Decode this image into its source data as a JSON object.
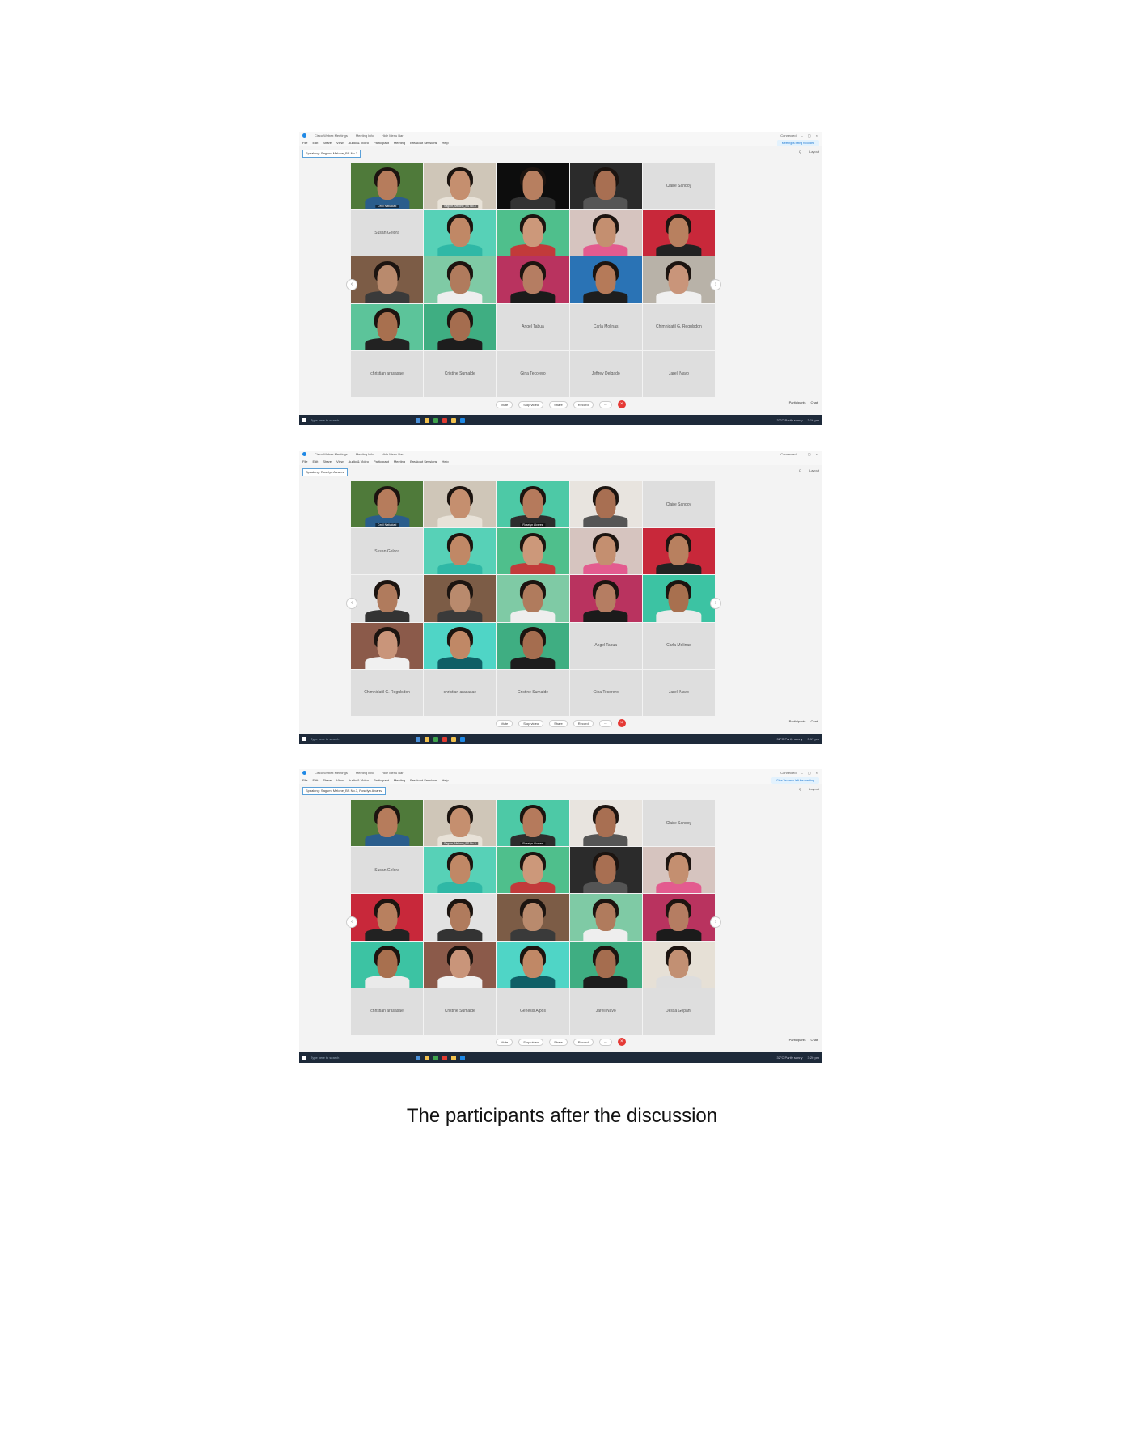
{
  "screenshots": [
    {
      "title_items": [
        "Cisco Webex Meetings",
        "Meeting Info",
        "Hide Menu Bar"
      ],
      "window_status": "Connected",
      "menu": [
        "File",
        "Edit",
        "Share",
        "View",
        "Audio & Video",
        "Participant",
        "Meeting",
        "Breakout Sessions",
        "Help"
      ],
      "banner": "Meeting is being recorded",
      "speaking": "Speaking: Sagum, Melone_BS No.3",
      "top_right": [
        "Q",
        "Layout"
      ],
      "tiles": [
        {
          "type": "video",
          "label": "Cecil Natividad",
          "active": true,
          "bg": "#4f7a3a",
          "skin": "#b67c5c",
          "shirt": "#2a5d8c"
        },
        {
          "type": "video",
          "label": "Sagum, Melone_BS No.3",
          "active": true,
          "bg": "#cfc6b8",
          "skin": "#c58f6f",
          "shirt": "#e8e2d8"
        },
        {
          "type": "video",
          "label": "",
          "bg": "#0d0d0d",
          "skin": "#b77f60",
          "shirt": "#333333"
        },
        {
          "type": "video",
          "label": "",
          "bg": "#2b2b2b",
          "skin": "#a86f52",
          "shirt": "#555555"
        },
        {
          "type": "name",
          "name": "Claire Sandoy"
        },
        {
          "type": "name",
          "name": "Susan Gelora"
        },
        {
          "type": "video",
          "label": "",
          "bg": "#57d1b7",
          "skin": "#c08866",
          "shirt": "#2fb8a6"
        },
        {
          "type": "video",
          "label": "",
          "bg": "#4fbf8c",
          "skin": "#cc987a",
          "shirt": "#c23a3a"
        },
        {
          "type": "video",
          "label": "",
          "bg": "#d6c4bf",
          "skin": "#c48f70",
          "shirt": "#e35b8f"
        },
        {
          "type": "video",
          "label": "",
          "bg": "#c8283a",
          "skin": "#b8805f",
          "shirt": "#222222"
        },
        {
          "type": "video",
          "label": "",
          "bg": "#7c5c46",
          "skin": "#b98a6d",
          "shirt": "#3a3a3a"
        },
        {
          "type": "video",
          "label": "",
          "bg": "#7fcaa5",
          "skin": "#b07b5d",
          "shirt": "#eeeeee"
        },
        {
          "type": "video",
          "label": "",
          "bg": "#b9335f",
          "skin": "#b57d62",
          "shirt": "#1b1b1b"
        },
        {
          "type": "video",
          "label": "",
          "bg": "#2a73b5",
          "skin": "#b57a59",
          "shirt": "#1e1e1e"
        },
        {
          "type": "video",
          "label": "",
          "bg": "#b8b2a8",
          "skin": "#c9957a",
          "shirt": "#f0f0f0"
        },
        {
          "type": "video",
          "label": "",
          "bg": "#5cc49a",
          "skin": "#a8704f",
          "shirt": "#222222"
        },
        {
          "type": "video",
          "label": "",
          "bg": "#3fae82",
          "skin": "#a56d4f",
          "shirt": "#1d1d1d"
        },
        {
          "type": "name",
          "name": "Angel Tabua"
        },
        {
          "type": "name",
          "name": "Carla Molinas"
        },
        {
          "type": "name",
          "name": "Chimnidatil G. Regulsdon"
        },
        {
          "type": "name",
          "name": "christian arasasae"
        },
        {
          "type": "name",
          "name": "Cristine Sumalde"
        },
        {
          "type": "name",
          "name": "Gina Tecorero"
        },
        {
          "type": "name",
          "name": "Jeffrey Delgado"
        },
        {
          "type": "name",
          "name": "Jarell Navo"
        }
      ],
      "controls": [
        "Mute",
        "Stop video",
        "Share",
        "Record"
      ],
      "right_controls": [
        "Participants",
        "Chat"
      ],
      "taskbar_search": "Type here to search",
      "taskbar_tray": "32°C Partly sunny",
      "taskbar_time": "3:16 pm"
    },
    {
      "title_items": [
        "Cisco Webex Meetings",
        "Meeting Info",
        "Hide Menu Bar"
      ],
      "window_status": "Connected",
      "menu": [
        "File",
        "Edit",
        "Share",
        "View",
        "Audio & Video",
        "Participant",
        "Meeting",
        "Breakout Sessions",
        "Help"
      ],
      "banner": "",
      "speaking": "Speaking: Roselyn Alvarez",
      "top_right": [
        "Q",
        "Layout"
      ],
      "tiles": [
        {
          "type": "video",
          "label": "Cecil Natividad",
          "active": true,
          "bg": "#4f7a3a",
          "skin": "#b67c5c",
          "shirt": "#2a5d8c"
        },
        {
          "type": "video",
          "label": "",
          "bg": "#cfc6b8",
          "skin": "#c58f6f",
          "shirt": "#e8e2d8"
        },
        {
          "type": "video",
          "label": "Roselyn Alvarez",
          "active": true,
          "bg": "#4dc9a6",
          "skin": "#b57a5c",
          "shirt": "#2d2d2d"
        },
        {
          "type": "video",
          "label": "",
          "bg": "#e8e4df",
          "skin": "#a86f52",
          "shirt": "#555555"
        },
        {
          "type": "name",
          "name": "Claire Sandoy"
        },
        {
          "type": "name",
          "name": "Susan Gelora"
        },
        {
          "type": "video",
          "label": "",
          "bg": "#57d1b7",
          "skin": "#c08866",
          "shirt": "#2fb8a6"
        },
        {
          "type": "video",
          "label": "",
          "bg": "#4fbf8c",
          "skin": "#cc987a",
          "shirt": "#c23a3a"
        },
        {
          "type": "video",
          "label": "",
          "bg": "#d6c4bf",
          "skin": "#c48f70",
          "shirt": "#e35b8f"
        },
        {
          "type": "video",
          "label": "",
          "bg": "#c8283a",
          "skin": "#b8805f",
          "shirt": "#222222"
        },
        {
          "type": "video",
          "label": "",
          "bg": "#e2e2e2",
          "skin": "#b07b5d",
          "shirt": "#333333"
        },
        {
          "type": "video",
          "label": "",
          "bg": "#7c5c46",
          "skin": "#b98a6d",
          "shirt": "#3a3a3a"
        },
        {
          "type": "video",
          "label": "",
          "bg": "#7fcaa5",
          "skin": "#b07b5d",
          "shirt": "#eeeeee"
        },
        {
          "type": "video",
          "label": "",
          "bg": "#b9335f",
          "skin": "#b57d62",
          "shirt": "#1b1b1b"
        },
        {
          "type": "video",
          "label": "",
          "bg": "#3cc3a3",
          "skin": "#a8704f",
          "shirt": "#eaeaea"
        },
        {
          "type": "video",
          "label": "",
          "bg": "#8b5a4a",
          "skin": "#c9957a",
          "shirt": "#f0f0f0"
        },
        {
          "type": "video",
          "label": "",
          "bg": "#4fd5c6",
          "skin": "#c08866",
          "shirt": "#0f5f66"
        },
        {
          "type": "video",
          "label": "",
          "bg": "#3fae82",
          "skin": "#a56d4f",
          "shirt": "#1d1d1d"
        },
        {
          "type": "name",
          "name": "Angel Tabua"
        },
        {
          "type": "name",
          "name": "Carla Molinas"
        },
        {
          "type": "name",
          "name": "Chimnidatil G. Regulsdon"
        },
        {
          "type": "name",
          "name": "christian arasasae"
        },
        {
          "type": "name",
          "name": "Cristine Sumalde"
        },
        {
          "type": "name",
          "name": "Gina Tecorero"
        },
        {
          "type": "name",
          "name": "Jarell Navo"
        }
      ],
      "controls": [
        "Mute",
        "Stop video",
        "Share",
        "Record"
      ],
      "right_controls": [
        "Participants",
        "Chat"
      ],
      "taskbar_search": "Type here to search",
      "taskbar_tray": "32°C Partly sunny",
      "taskbar_time": "3:17 pm"
    },
    {
      "title_items": [
        "Cisco Webex Meetings",
        "Meeting Info",
        "Hide Menu Bar"
      ],
      "window_status": "Connected",
      "menu": [
        "File",
        "Edit",
        "Share",
        "View",
        "Audio & Video",
        "Participant",
        "Meeting",
        "Breakout Sessions",
        "Help"
      ],
      "banner": "Gina Tecorero left the meeting",
      "speaking": "Speaking: Sagum, Melone_BS No.3, Roselyn Alvarez",
      "top_right": [
        "Q",
        "Layout"
      ],
      "tiles": [
        {
          "type": "video",
          "label": "",
          "bg": "#4f7a3a",
          "skin": "#b67c5c",
          "shirt": "#2a5d8c"
        },
        {
          "type": "video",
          "label": "Sagum, Melone_BS No.3",
          "active": true,
          "bg": "#cfc6b8",
          "skin": "#c58f6f",
          "shirt": "#e8e2d8"
        },
        {
          "type": "video",
          "label": "Roselyn Alvarez",
          "active": true,
          "bg": "#4dc9a6",
          "skin": "#b57a5c",
          "shirt": "#2d2d2d"
        },
        {
          "type": "video",
          "label": "",
          "bg": "#e8e4df",
          "skin": "#a86f52",
          "shirt": "#555555"
        },
        {
          "type": "name",
          "name": "Claire Sandoy"
        },
        {
          "type": "name",
          "name": "Susan Gelora"
        },
        {
          "type": "video",
          "label": "",
          "bg": "#57d1b7",
          "skin": "#c08866",
          "shirt": "#2fb8a6"
        },
        {
          "type": "video",
          "label": "",
          "bg": "#4fbf8c",
          "skin": "#cc987a",
          "shirt": "#c23a3a"
        },
        {
          "type": "video",
          "label": "",
          "bg": "#2b2b2b",
          "skin": "#a86f52",
          "shirt": "#555555"
        },
        {
          "type": "video",
          "label": "",
          "bg": "#d6c4bf",
          "skin": "#c48f70",
          "shirt": "#e35b8f"
        },
        {
          "type": "video",
          "label": "",
          "bg": "#c8283a",
          "skin": "#b8805f",
          "shirt": "#222222"
        },
        {
          "type": "video",
          "label": "",
          "bg": "#e2e2e2",
          "skin": "#b07b5d",
          "shirt": "#333333"
        },
        {
          "type": "video",
          "label": "",
          "bg": "#7c5c46",
          "skin": "#b98a6d",
          "shirt": "#3a3a3a"
        },
        {
          "type": "video",
          "label": "",
          "bg": "#7fcaa5",
          "skin": "#b07b5d",
          "shirt": "#eeeeee"
        },
        {
          "type": "video",
          "label": "",
          "bg": "#b9335f",
          "skin": "#b57d62",
          "shirt": "#1b1b1b"
        },
        {
          "type": "video",
          "label": "",
          "bg": "#3cc3a3",
          "skin": "#a8704f",
          "shirt": "#eaeaea"
        },
        {
          "type": "video",
          "label": "",
          "bg": "#8b5a4a",
          "skin": "#c9957a",
          "shirt": "#f0f0f0"
        },
        {
          "type": "video",
          "label": "",
          "bg": "#4fd5c6",
          "skin": "#c08866",
          "shirt": "#0f5f66"
        },
        {
          "type": "video",
          "label": "",
          "bg": "#3fae82",
          "skin": "#a56d4f",
          "shirt": "#1d1d1d"
        },
        {
          "type": "video",
          "label": "",
          "bg": "#e6e0d6",
          "skin": "#c29073",
          "shirt": "#dddddd"
        },
        {
          "type": "name",
          "name": "christian arasasae"
        },
        {
          "type": "name",
          "name": "Cristine Sumalde"
        },
        {
          "type": "name",
          "name": "Genesis Alpos"
        },
        {
          "type": "name",
          "name": "Jarell Navo"
        },
        {
          "type": "name",
          "name": "Jessa Gopani"
        }
      ],
      "controls": [
        "Mute",
        "Stop video",
        "Share",
        "Record"
      ],
      "right_controls": [
        "Participants",
        "Chat"
      ],
      "taskbar_search": "Type here to search",
      "taskbar_tray": "32°C Partly sunny",
      "taskbar_time": "3:20 pm"
    }
  ],
  "caption": "The participants after the discussion"
}
